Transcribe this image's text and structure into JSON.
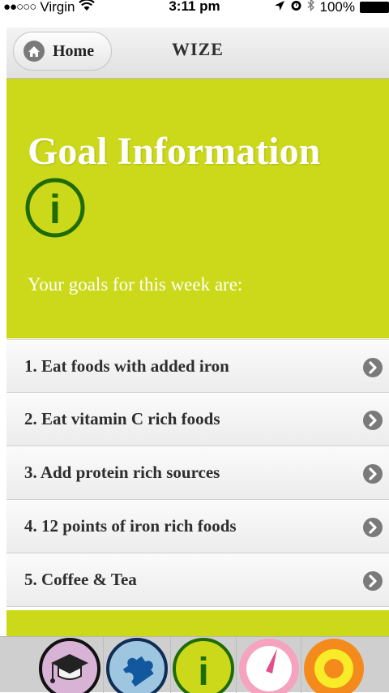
{
  "status_bar": {
    "signal": "●●○○○",
    "carrier": "Virgin",
    "wifi_glyph": "ᯤ",
    "time": "3:11 pm",
    "location_glyph": "➚",
    "alarm_glyph": "⏰",
    "bluetooth_glyph": "✻",
    "battery": "100%"
  },
  "nav": {
    "home_label": "Home",
    "title": "WIZE"
  },
  "hero": {
    "title": "Goal Information",
    "subtitle": "Your goals for this week are:",
    "info_glyph": "i"
  },
  "goals": [
    {
      "label": "1. Eat foods with added iron"
    },
    {
      "label": "2. Eat vitamin C rich foods"
    },
    {
      "label": "3. Add protein rich sources"
    },
    {
      "label": "4. 12 points of iron rich foods"
    },
    {
      "label": "5. Coffee & Tea"
    }
  ],
  "tab_bar": {
    "tabs": [
      {
        "icon": "graduation-cap-icon"
      },
      {
        "icon": "puzzle-piece-icon"
      },
      {
        "icon": "info-icon",
        "glyph": "i"
      },
      {
        "icon": "gauge-icon"
      },
      {
        "icon": "target-icon"
      }
    ]
  },
  "colors": {
    "accent_green": "#ccd91a",
    "info_dark_green": "#1e6b00",
    "text_dark": "#2e2e2e"
  }
}
